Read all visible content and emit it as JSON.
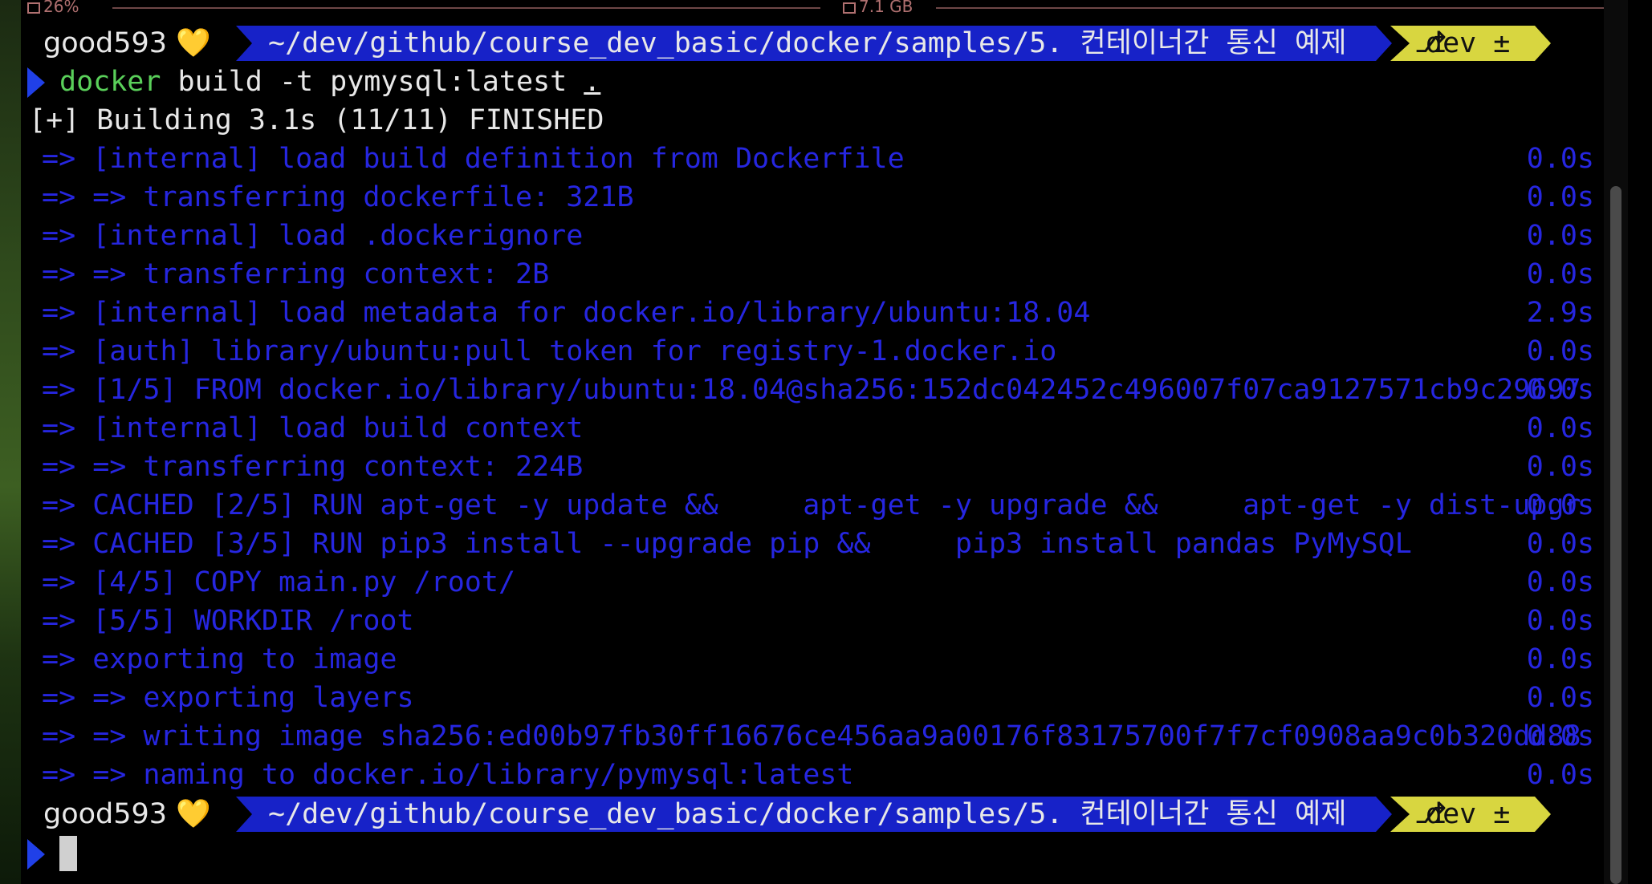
{
  "statusbar": {
    "cpu": "26%",
    "memory": "7.1 GB"
  },
  "prompt": {
    "user": "good593",
    "emoji": "💛",
    "path": "~/dev/github/course_dev_basic/docker/samples/5. 컨테이너간 통신 예제",
    "branch_icon": "git-branch-icon",
    "branch": "dev ±"
  },
  "command": {
    "program": "docker",
    "args": " build -t pymysql:latest ",
    "context": "."
  },
  "build_header": "[+] Building 3.1s (11/11) FINISHED",
  "steps": [
    {
      "text": "=> [internal] load build definition from Dockerfile",
      "time": "0.0s"
    },
    {
      "text": "=> => transferring dockerfile: 321B",
      "time": "0.0s"
    },
    {
      "text": "=> [internal] load .dockerignore",
      "time": "0.0s"
    },
    {
      "text": "=> => transferring context: 2B",
      "time": "0.0s"
    },
    {
      "text": "=> [internal] load metadata for docker.io/library/ubuntu:18.04",
      "time": "2.9s"
    },
    {
      "text": "=> [auth] library/ubuntu:pull token for registry-1.docker.io",
      "time": "0.0s"
    },
    {
      "text": "=> [1/5] FROM docker.io/library/ubuntu:18.04@sha256:152dc042452c496007f07ca9127571cb9c29697",
      "time": "0.0s"
    },
    {
      "text": "=> [internal] load build context",
      "time": "0.0s"
    },
    {
      "text": "=> => transferring context: 224B",
      "time": "0.0s"
    },
    {
      "text": "=> CACHED [2/5] RUN apt-get -y update &&     apt-get -y upgrade &&     apt-get -y dist-upgr",
      "time": "0.0s"
    },
    {
      "text": "=> CACHED [3/5] RUN pip3 install --upgrade pip &&     pip3 install pandas PyMySQL",
      "time": "0.0s"
    },
    {
      "text": "=> [4/5] COPY main.py /root/",
      "time": "0.0s"
    },
    {
      "text": "=> [5/5] WORKDIR /root",
      "time": "0.0s"
    },
    {
      "text": "=> exporting to image",
      "time": "0.0s"
    },
    {
      "text": "=> => exporting layers",
      "time": "0.0s"
    },
    {
      "text": "=> => writing image sha256:ed00b97fb30ff16676ce456aa9a00176f83175700f7f7cf0908aa9c0b320dd88",
      "time": "0.0s"
    },
    {
      "text": "=> => naming to docker.io/library/pymysql:latest",
      "time": "0.0s"
    }
  ]
}
